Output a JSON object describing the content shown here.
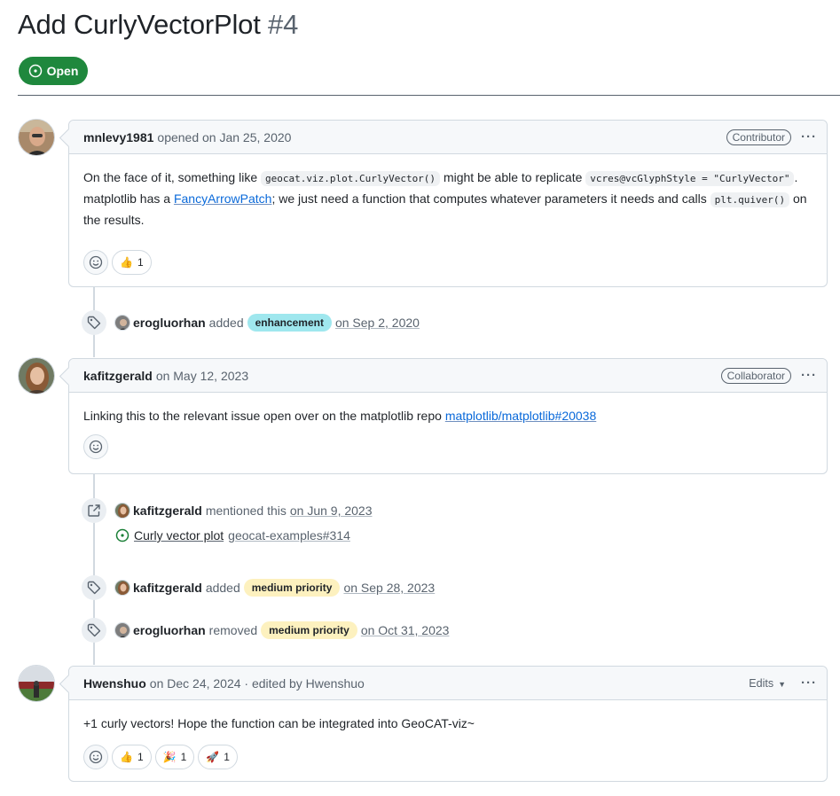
{
  "issue": {
    "title": "Add CurlyVectorPlot",
    "number": "#4",
    "state": "Open"
  },
  "comments": [
    {
      "author": "mnlevy1981",
      "meta": "opened on Jan 25, 2020",
      "role": "Contributor",
      "body": {
        "t1": "On the face of it, something like ",
        "code1": "geocat.viz.plot.CurlyVector()",
        "t2": " might be able to replicate ",
        "code2": "vcres@vcGlyphStyle = \"CurlyVector\"",
        "t3": ". matplotlib has a ",
        "link1": "FancyArrowPatch",
        "t4": "; we just need a function that computes whatever parameters it needs and calls ",
        "code3": "plt.quiver()",
        "t5": " on the results."
      },
      "reactions": [
        {
          "emoji": "👍",
          "count": "1"
        }
      ]
    },
    {
      "author": "kafitzgerald",
      "meta": "on May 12, 2023",
      "role": "Collaborator",
      "body": {
        "t1": "Linking this to the relevant issue open over on the matplotlib repo ",
        "link1": "matplotlib/matplotlib#20038"
      },
      "reactions": []
    },
    {
      "author": "Hwenshuo",
      "meta": "on Dec 24, 2024 · edited by Hwenshuo",
      "edits_label": "Edits",
      "body": {
        "t1": "+1 curly vectors!  Hope the function can be integrated into GeoCAT-viz~"
      },
      "reactions": [
        {
          "emoji": "👍",
          "count": "1"
        },
        {
          "emoji": "🎉",
          "count": "1"
        },
        {
          "emoji": "🚀",
          "count": "1"
        }
      ]
    }
  ],
  "events": [
    {
      "icon": "tag-icon",
      "author": "erogluorhan",
      "action": "added",
      "label": "enhancement",
      "label_bg": "#9fe7ee",
      "label_fg": "#1f2328",
      "date": "on Sep 2, 2020"
    },
    {
      "icon": "cross-reference-icon",
      "author": "kafitzgerald",
      "action": "mentioned this",
      "date": "on Jun 9, 2023",
      "xref": {
        "title": "Curly vector plot",
        "repo": "geocat-examples#314"
      }
    },
    {
      "icon": "tag-icon",
      "author": "kafitzgerald",
      "action": "added",
      "label": "medium priority",
      "label_bg": "#fdf1bf",
      "label_fg": "#1f2328",
      "date": "on Sep 28, 2023"
    },
    {
      "icon": "tag-icon",
      "author": "erogluorhan",
      "action": "removed",
      "label": "medium priority",
      "label_bg": "#fdf1bf",
      "label_fg": "#1f2328",
      "date": "on Oct 31, 2023"
    }
  ],
  "colors": {
    "open_green": "#1f883d",
    "link_blue": "#0969da",
    "muted": "#59636e",
    "border": "#d1d9e0"
  }
}
